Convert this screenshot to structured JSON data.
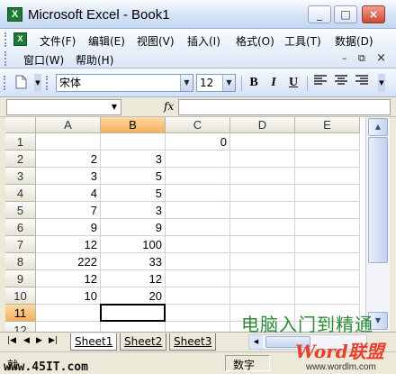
{
  "window": {
    "title": "Microsoft Excel - Book1",
    "app_icon": "X",
    "controls": {
      "minimize": "_",
      "maximize": "□",
      "close": "×"
    }
  },
  "menu": {
    "items_row1": [
      "文件(F)",
      "编辑(E)",
      "视图(V)",
      "插入(I)",
      "格式(O)",
      "工具(T)",
      "数据(D)"
    ],
    "items_row2": [
      "窗口(W)",
      "帮助(H)"
    ],
    "doc_controls": {
      "minimize": "–",
      "restore": "⧉",
      "close": "×"
    }
  },
  "toolbar": {
    "font_name": "宋体",
    "font_size": "12",
    "bold": "B",
    "italic": "I",
    "underline": "U"
  },
  "formula_bar": {
    "name_box": "",
    "fx": "fx",
    "formula": ""
  },
  "grid": {
    "columns": [
      "A",
      "B",
      "C",
      "D",
      "E"
    ],
    "rows": [
      "1",
      "2",
      "3",
      "4",
      "5",
      "6",
      "7",
      "8",
      "9",
      "10",
      "11",
      "12"
    ],
    "cells": [
      [
        "",
        "",
        "0",
        "",
        ""
      ],
      [
        "2",
        "3",
        "",
        "",
        ""
      ],
      [
        "3",
        "5",
        "",
        "",
        ""
      ],
      [
        "4",
        "5",
        "",
        "",
        ""
      ],
      [
        "7",
        "3",
        "",
        "",
        ""
      ],
      [
        "9",
        "9",
        "",
        "",
        ""
      ],
      [
        "12",
        "100",
        "",
        "",
        ""
      ],
      [
        "222",
        "33",
        "",
        "",
        ""
      ],
      [
        "12",
        "12",
        "",
        "",
        ""
      ],
      [
        "10",
        "20",
        "",
        "",
        ""
      ],
      [
        "",
        "",
        "",
        "",
        ""
      ],
      [
        "",
        "",
        "",
        "",
        ""
      ]
    ],
    "active_row": "11",
    "active_column": "B"
  },
  "sheets": {
    "tabs": [
      "Sheet1",
      "Sheet2",
      "Sheet3"
    ],
    "active": "Sheet1"
  },
  "status": {
    "left": "就",
    "mode": "数字"
  },
  "watermarks": {
    "site": "www.45IT.com",
    "chinese": "电脑入门到精通",
    "logo": "Word联盟",
    "url": "www.wordlm.com"
  },
  "colors": {
    "active_header": "#f6b15b",
    "title_gradient": "#d5e3f7",
    "watermark_green": "#2b8a36",
    "watermark_red": "#e8402c"
  }
}
